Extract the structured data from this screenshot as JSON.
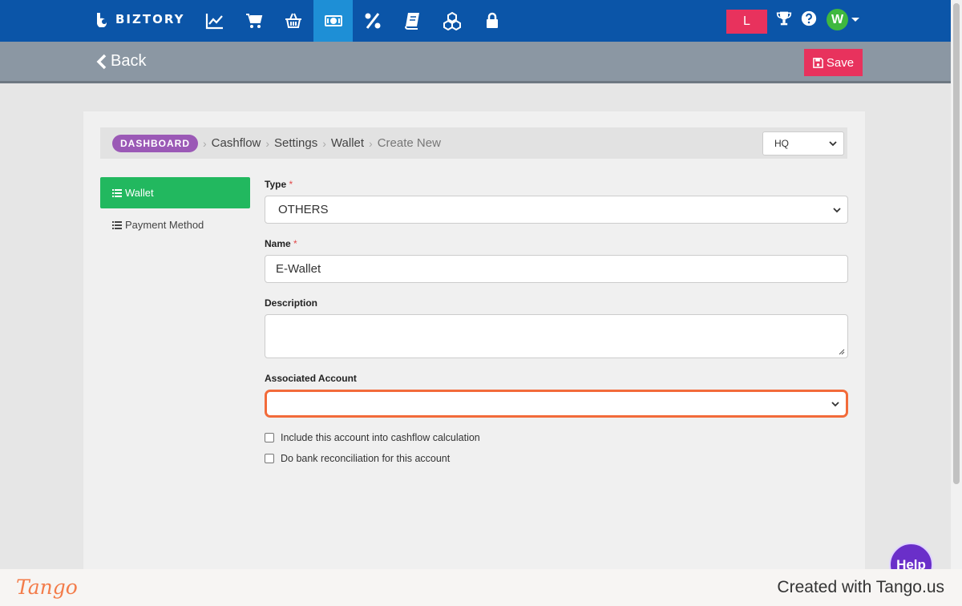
{
  "app": {
    "logo_text": "BIZTORY",
    "nav_icons": [
      "chart-line-icon",
      "cart-icon",
      "basket-icon",
      "money-icon",
      "percent-icon",
      "book-icon",
      "cubes-icon",
      "lock-icon"
    ],
    "active_nav": "money-icon",
    "user_badge": "L",
    "avatar_letter": "W"
  },
  "subbar": {
    "back_label": "Back",
    "save_label": "Save"
  },
  "breadcrumb": {
    "badge": "DASHBOARD",
    "items": [
      "Cashflow",
      "Settings",
      "Wallet",
      "Create New"
    ],
    "branch_select": "HQ"
  },
  "sidebar": {
    "items": [
      {
        "label": "Wallet",
        "active": true
      },
      {
        "label": "Payment Method",
        "active": false
      }
    ]
  },
  "form": {
    "type_label": "Type",
    "type_value": "OTHERS",
    "name_label": "Name",
    "name_value": "E-Wallet",
    "description_label": "Description",
    "description_value": "",
    "associated_account_label": "Associated Account",
    "associated_account_value": "",
    "required_mark": "*",
    "checkbox_cashflow": "Include this account into cashflow calculation",
    "checkbox_reconciliation": "Do bank reconciliation for this account"
  },
  "help_label": "Help",
  "footer": {
    "brand": "Tango",
    "created_text": "Created with Tango.us"
  },
  "colors": {
    "navbar": "#0b55a8",
    "active_nav": "#1e8fd6",
    "accent_red": "#e8325d",
    "sidebar_active": "#22b85f",
    "breadcrumb_badge": "#9b59b6",
    "highlight": "#f26b3a",
    "tango": "#f37c4a"
  }
}
